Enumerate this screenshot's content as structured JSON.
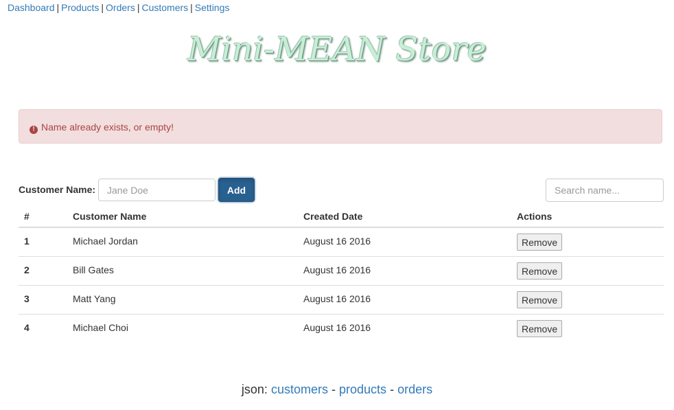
{
  "nav": {
    "links": [
      "Dashboard",
      "Products",
      "Orders",
      "Customers",
      "Settings"
    ],
    "separator": "|"
  },
  "brand": {
    "title": "Mini-MEAN Store"
  },
  "alert": {
    "icon": "exclamation-circle-icon",
    "message": "Name already exists, or empty!"
  },
  "form": {
    "label": "Customer Name:",
    "name_placeholder": "Jane Doe",
    "add_label": "Add",
    "search_placeholder": "Search name..."
  },
  "table": {
    "headers": [
      "#",
      "Customer Name",
      "Created Date",
      "Actions"
    ],
    "rows": [
      {
        "num": "1",
        "name": "Michael Jordan",
        "date": "August 16 2016",
        "action": "Remove"
      },
      {
        "num": "2",
        "name": "Bill Gates",
        "date": "August 16 2016",
        "action": "Remove"
      },
      {
        "num": "3",
        "name": "Matt Yang",
        "date": "August 16 2016",
        "action": "Remove"
      },
      {
        "num": "4",
        "name": "Michael Choi",
        "date": "August 16 2016",
        "action": "Remove"
      }
    ]
  },
  "footer": {
    "prefix": "json:",
    "links": [
      "customers",
      "products",
      "orders"
    ],
    "separator": "-"
  },
  "colors": {
    "link": "#337ab7",
    "alert_bg": "#f2dede",
    "alert_text": "#a94442",
    "primary": "#286090"
  }
}
